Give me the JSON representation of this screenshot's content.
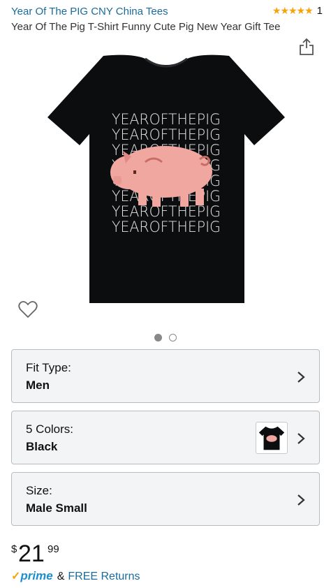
{
  "header": {
    "brand": "Year Of The PIG CNY China Tees",
    "stars": "★★★★★",
    "rating_count": "1",
    "title": "Year Of The Pig T-Shirt Funny Cute Pig New Year Gift Tee"
  },
  "product_image": {
    "shirt_color": "#0c0d0f",
    "pig_color": "#f0a7a0",
    "print_lines": [
      "YEAROFTHEPIG",
      "YEAROFTHEPIG",
      "YEAROFTHEPIG",
      "YEAROFTHEPIG",
      "YEAROFTHEPIG",
      "YEAROFTHEPIG",
      "YEAROFTHEPIG",
      "YEAROFTHEPIG"
    ]
  },
  "carousel": {
    "count": 2,
    "active": 1
  },
  "options": {
    "fit": {
      "label": "Fit Type:",
      "value": "Men"
    },
    "colors": {
      "label": "5 Colors:",
      "value": "Black"
    },
    "size": {
      "label": "Size:",
      "value": "Male Small"
    }
  },
  "price": {
    "currency": "$",
    "whole": "21",
    "fraction": "99"
  },
  "shipping": {
    "check": "✓",
    "prime": "prime",
    "amp": "&",
    "free_returns": "FREE Returns"
  },
  "colors": {
    "link": "#1a6b9a",
    "star": "#f7a30a",
    "prime": "#1a8fcf"
  }
}
